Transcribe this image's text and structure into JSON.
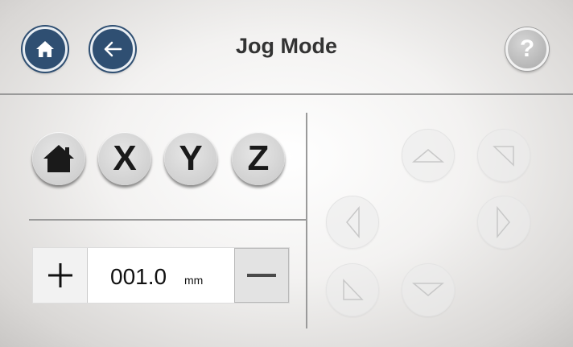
{
  "header": {
    "title": "Jog Mode",
    "help_symbol": "?",
    "home_icon": "home-icon",
    "back_icon": "arrow-left-icon"
  },
  "axes": {
    "home_all_icon": "home-icon",
    "x_label": "X",
    "y_label": "Y",
    "z_label": "Z"
  },
  "step": {
    "value": "001.0",
    "unit": "mm",
    "plus_icon": "plus-icon",
    "minus_icon": "minus-icon"
  },
  "jog_pad": {
    "buttons": [
      "arrow-up",
      "arrow-diagonal-down-right",
      "arrow-left",
      "arrow-right",
      "arrow-diagonal-up-left",
      "arrow-down"
    ],
    "state": "disabled"
  },
  "colors": {
    "nav_blue": "#2f4f72",
    "help_gray": "#b3b3b3",
    "divider": "#9a9a9a"
  }
}
